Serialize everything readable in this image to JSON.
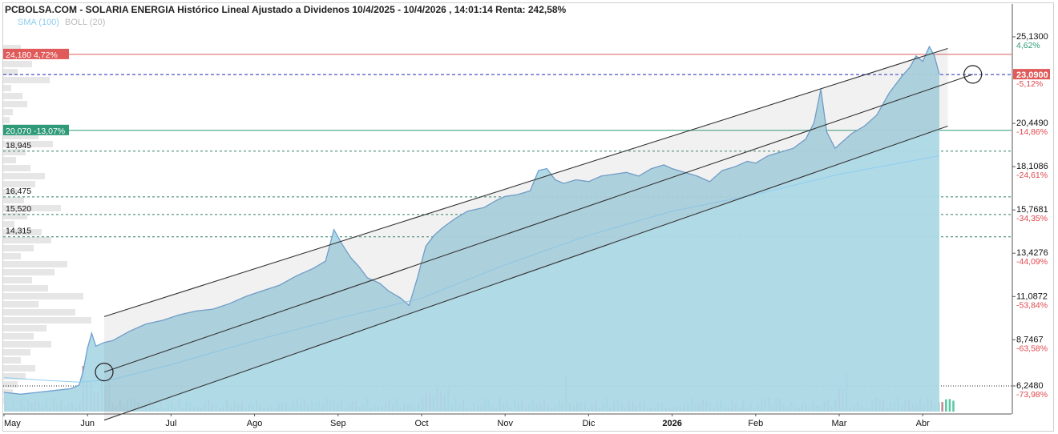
{
  "header": {
    "title": "PCBOLSA.COM - SOLARIA ENERGIA Histórico Lineal Ajustado a Dividenos 10/4/2025 - 10/4/2026 , 14:01:14 Renta: 242,58%",
    "legend_sma": "SMA (100)",
    "legend_boll": "BOLL (20)"
  },
  "colors": {
    "area_fill": "#add8e6",
    "price_line": "#6e9fcf",
    "sma_line": "#8ecdf0",
    "resistance": "#e05a5a",
    "support": "#2e9a78",
    "current": "#1c2ab8",
    "vol_up": "#5cc7a6",
    "vol_down": "#c48a96",
    "pct_up": "#2e9a78",
    "pct_down": "#e0474c"
  },
  "levels": {
    "resistance": {
      "price": "24,180",
      "pct": "4,72%",
      "value": 24.18
    },
    "support": {
      "price": "20,070",
      "pct": "-13,07%",
      "value": 20.07
    },
    "current": {
      "price": "23,0900",
      "pct": "-5,12%",
      "value": 23.09
    },
    "dashed": [
      {
        "label": "18,945",
        "value": 18.945
      },
      {
        "label": "16,475",
        "value": 16.475
      },
      {
        "label": "15,520",
        "value": 15.52
      },
      {
        "label": "14,315",
        "value": 14.315
      }
    ]
  },
  "chart_data": {
    "type": "area",
    "ylim": [
      5.0,
      26.1
    ],
    "y_ticks": [
      {
        "value": 25.13,
        "label": "25,1300",
        "pct": "4,62%",
        "dir": "up"
      },
      {
        "value": 20.449,
        "label": "20,4490",
        "pct": "-14,86%",
        "dir": "down"
      },
      {
        "value": 18.1086,
        "label": "18,1086",
        "pct": "-24,61%",
        "dir": "down"
      },
      {
        "value": 15.7681,
        "label": "15,7681",
        "pct": "-34,35%",
        "dir": "down"
      },
      {
        "value": 13.4276,
        "label": "13,4276",
        "pct": "-44,09%",
        "dir": "down"
      },
      {
        "value": 11.0872,
        "label": "11,0872",
        "pct": "-53,84%",
        "dir": "down"
      },
      {
        "value": 8.7467,
        "label": "8,7467",
        "pct": "-63,58%",
        "dir": "down"
      },
      {
        "value": 6.248,
        "label": "6,2480",
        "pct": "-73,98%",
        "dir": "down"
      }
    ],
    "x_labels": [
      {
        "label": "May",
        "t": 0,
        "bold": false
      },
      {
        "label": "Jun",
        "t": 1,
        "bold": false
      },
      {
        "label": "Jul",
        "t": 2,
        "bold": false
      },
      {
        "label": "Ago",
        "t": 3,
        "bold": false
      },
      {
        "label": "Sep",
        "t": 4,
        "bold": false
      },
      {
        "label": "Oct",
        "t": 5,
        "bold": false
      },
      {
        "label": "Nov",
        "t": 6,
        "bold": false
      },
      {
        "label": "Dic",
        "t": 7,
        "bold": false
      },
      {
        "label": "2026",
        "t": 8,
        "bold": true
      },
      {
        "label": "Feb",
        "t": 9,
        "bold": false
      },
      {
        "label": "Mar",
        "t": 10,
        "bold": false
      },
      {
        "label": "Abr",
        "t": 11,
        "bold": false
      }
    ],
    "x_range": [
      0,
      11.6
    ],
    "price_series": [
      [
        0.0,
        5.9
      ],
      [
        0.2,
        5.8
      ],
      [
        0.4,
        5.9
      ],
      [
        0.6,
        6.0
      ],
      [
        0.8,
        6.1
      ],
      [
        0.9,
        6.3
      ],
      [
        0.95,
        7.1
      ],
      [
        1.0,
        8.3
      ],
      [
        1.05,
        9.1
      ],
      [
        1.1,
        8.4
      ],
      [
        1.2,
        8.6
      ],
      [
        1.3,
        8.7
      ],
      [
        1.5,
        9.2
      ],
      [
        1.7,
        9.6
      ],
      [
        1.9,
        9.8
      ],
      [
        2.1,
        10.1
      ],
      [
        2.3,
        10.3
      ],
      [
        2.5,
        10.4
      ],
      [
        2.7,
        10.7
      ],
      [
        2.9,
        11.1
      ],
      [
        3.1,
        11.4
      ],
      [
        3.3,
        11.7
      ],
      [
        3.5,
        12.2
      ],
      [
        3.7,
        12.6
      ],
      [
        3.85,
        13.0
      ],
      [
        3.95,
        14.7
      ],
      [
        4.05,
        13.9
      ],
      [
        4.15,
        13.2
      ],
      [
        4.25,
        12.7
      ],
      [
        4.35,
        12.1
      ],
      [
        4.5,
        11.8
      ],
      [
        4.6,
        11.4
      ],
      [
        4.75,
        11.0
      ],
      [
        4.85,
        10.6
      ],
      [
        4.95,
        12.1
      ],
      [
        5.05,
        13.8
      ],
      [
        5.15,
        14.4
      ],
      [
        5.25,
        14.8
      ],
      [
        5.4,
        15.3
      ],
      [
        5.55,
        15.7
      ],
      [
        5.75,
        15.9
      ],
      [
        5.9,
        16.3
      ],
      [
        6.0,
        16.5
      ],
      [
        6.15,
        16.6
      ],
      [
        6.3,
        16.8
      ],
      [
        6.4,
        17.9
      ],
      [
        6.5,
        18.0
      ],
      [
        6.6,
        17.4
      ],
      [
        6.7,
        17.2
      ],
      [
        6.85,
        17.4
      ],
      [
        7.0,
        17.3
      ],
      [
        7.15,
        17.6
      ],
      [
        7.3,
        17.7
      ],
      [
        7.45,
        17.8
      ],
      [
        7.6,
        17.6
      ],
      [
        7.75,
        18.0
      ],
      [
        7.9,
        18.2
      ],
      [
        8.0,
        18.0
      ],
      [
        8.15,
        17.8
      ],
      [
        8.3,
        17.6
      ],
      [
        8.45,
        17.3
      ],
      [
        8.6,
        17.9
      ],
      [
        8.75,
        18.1
      ],
      [
        8.9,
        18.4
      ],
      [
        9.0,
        18.3
      ],
      [
        9.15,
        18.7
      ],
      [
        9.3,
        18.9
      ],
      [
        9.45,
        19.1
      ],
      [
        9.6,
        19.6
      ],
      [
        9.7,
        20.5
      ],
      [
        9.78,
        22.3
      ],
      [
        9.85,
        20.0
      ],
      [
        9.95,
        19.1
      ],
      [
        10.05,
        19.5
      ],
      [
        10.15,
        19.9
      ],
      [
        10.3,
        20.3
      ],
      [
        10.45,
        20.9
      ],
      [
        10.6,
        22.1
      ],
      [
        10.75,
        23.0
      ],
      [
        10.85,
        23.5
      ],
      [
        10.92,
        24.1
      ],
      [
        11.0,
        23.8
      ],
      [
        11.08,
        24.6
      ],
      [
        11.14,
        24.1
      ],
      [
        11.2,
        23.09
      ]
    ],
    "sma_series": [
      [
        0.0,
        6.7
      ],
      [
        0.5,
        6.55
      ],
      [
        0.9,
        6.45
      ],
      [
        1.3,
        6.6
      ],
      [
        2.0,
        7.4
      ],
      [
        3.0,
        8.7
      ],
      [
        4.0,
        9.9
      ],
      [
        5.0,
        11.0
      ],
      [
        6.0,
        12.8
      ],
      [
        7.0,
        14.4
      ],
      [
        8.0,
        15.7
      ],
      [
        9.0,
        16.6
      ],
      [
        10.0,
        17.7
      ],
      [
        11.2,
        18.7
      ]
    ],
    "trend_channel": {
      "upper": [
        [
          1.2,
          10.0
        ],
        [
          11.3,
          24.5
        ]
      ],
      "middle": [
        [
          1.2,
          7.0
        ],
        [
          11.6,
          23.1
        ]
      ],
      "lower": [
        [
          1.2,
          4.4
        ],
        [
          11.3,
          20.3
        ]
      ]
    },
    "volume_baseline_price": 6.248
  }
}
